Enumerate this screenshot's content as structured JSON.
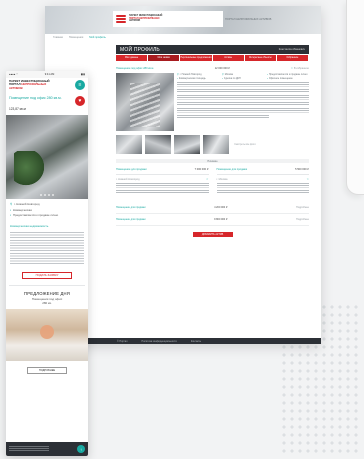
{
  "brand": {
    "line1": "ПАРКЕТ ИНВЕСТИЦИОННЫЙ",
    "line2": "ПОРТАЛ",
    "accent": "НЕПРОФИЛЬНЫХ",
    "line3": "АКТИВОВ",
    "hero_tagline": "ПОРТАЛ НЕПРОФИЛЬНЫХ АКТИВОВ"
  },
  "desktop": {
    "breadcrumbs": [
      "Главная",
      "Помещения",
      "Мой профиль"
    ],
    "title": "МОЙ ПРОФИЛЬ",
    "user": "Константин Иванович",
    "tabs": [
      "Мои данные",
      "Мои заявки",
      "Персональные предложения",
      "Активы",
      "Интересные объекты",
      "Избранное"
    ],
    "listing": {
      "title": "Помещение под офис 280 кв.м.",
      "price": "12 000 000 ₽",
      "favorite": "В избранное",
      "meta": [
        "г. Нижний Новгород",
        "Москва",
        "Предоставляется к продаже лично",
        "Коммерческая площадь",
        "Сделка по ДКП",
        "Офисное помещение"
      ],
      "more_photos": "Смотреть все фото",
      "separator": "Похожие"
    },
    "offers": [
      {
        "title": "Помещение для продажи",
        "price": "7 000 000 ₽",
        "city": "г. Нижний Новгород"
      },
      {
        "title": "Помещение для продажи",
        "price": "5 500 000 ₽",
        "city": "г. Москва"
      }
    ],
    "list": [
      {
        "title": "Помещение для продажи",
        "price": "4 200 000 ₽",
        "action": "Подробнее"
      },
      {
        "title": "Помещение для продажи",
        "price": "9 800 000 ₽",
        "action": "Подробнее"
      }
    ],
    "cta": "ДОБАВИТЬ АКТИВ",
    "footer": [
      "© Портал",
      "Политика конфиденциальности",
      "Контакты"
    ]
  },
  "mobile": {
    "status": {
      "left": "●●●● ◠",
      "time": "9:41 AM",
      "right": "▮▮▮"
    },
    "listing_link": "Помещение под офис 280 кв.м.",
    "size": "123,87 кв.м",
    "details": [
      "г. Нижний Новгород",
      "Коммерческая",
      "Предоставляется к продаже лично"
    ],
    "type": "Коммерческая недвижимость",
    "button": "ПОДАТЬ ЗАЯВКУ",
    "offer_title": "ПРЕДЛОЖЕНИЕ ДНЯ",
    "offer_sub1": "Помещения под офис",
    "offer_sub2": "280 кв.",
    "offer_button": "ПОДРОБНЕЕ"
  },
  "icons": {
    "menu": "menu-icon",
    "star": "star-icon",
    "location": "pin-icon",
    "arrow": "arrow-up-icon"
  },
  "colors": {
    "accent": "#d6262a",
    "teal": "#18a9a1",
    "dark": "#2c3036"
  }
}
